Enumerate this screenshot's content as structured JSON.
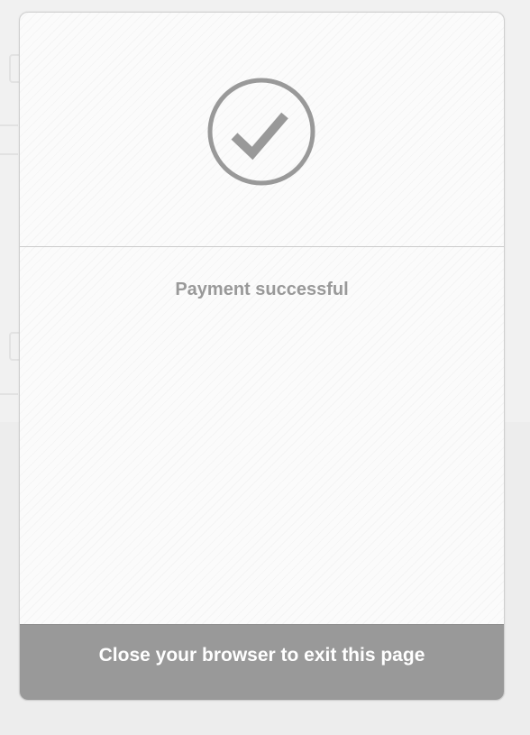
{
  "status": {
    "icon": "check-circle-icon",
    "message": "Payment successful"
  },
  "footer": {
    "text": "Close your browser to exit this page"
  },
  "colors": {
    "icon": "#999999",
    "message": "#999999",
    "footer_bg": "#999999",
    "footer_text": "#ffffff"
  }
}
